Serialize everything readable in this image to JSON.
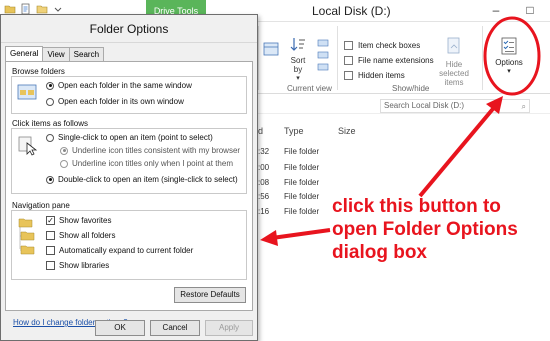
{
  "explorer": {
    "window_title": "Local Disk (D:)",
    "contextual_tab": "Drive Tools",
    "window_controls": {
      "minimize": "–",
      "maximize": "□"
    },
    "ribbon": {
      "sort_label": "Sort",
      "sort_label_2": "by",
      "current_view_label": "Current view",
      "show_hide_label": "Show/hide",
      "checkboxes": [
        {
          "label": "Item check boxes"
        },
        {
          "label": "File name extensions"
        },
        {
          "label": "Hidden items"
        }
      ],
      "hide_selected": "Hide selected",
      "hide_selected_2": "items",
      "options_label": "Options"
    },
    "search_placeholder": "Search Local Disk (D:)",
    "columns": {
      "type": "Type",
      "size": "Size"
    },
    "rows": [
      {
        "time": ":32",
        "type": "File folder"
      },
      {
        "time": ":00",
        "type": "File folder"
      },
      {
        "time": ":08",
        "type": "File folder"
      },
      {
        "time": ":56",
        "type": "File folder"
      },
      {
        "time": ":16",
        "type": "File folder"
      }
    ]
  },
  "dialog": {
    "title": "Folder Options",
    "tabs": [
      "General",
      "View",
      "Search"
    ],
    "browse_folders": {
      "label": "Browse folders",
      "options": [
        "Open each folder in the same window",
        "Open each folder in its own window"
      ]
    },
    "click_items": {
      "label": "Click items as follows",
      "options": [
        "Single-click to open an item (point to select)",
        "Underline icon titles consistent with my browser",
        "Underline icon titles only when I point at them",
        "Double-click to open an item (single-click to select)"
      ]
    },
    "navigation_pane": {
      "label": "Navigation pane",
      "options": [
        "Show favorites",
        "Show all folders",
        "Automatically expand to current folder",
        "Show libraries"
      ]
    },
    "restore_defaults": "Restore Defaults",
    "help_link": "How do I change folder options?",
    "ok": "OK",
    "cancel": "Cancel",
    "apply": "Apply"
  },
  "annotation": {
    "line1": "click this button to",
    "line2": "open Folder Options",
    "line3": "dialog box",
    "color": "#e8141e"
  }
}
